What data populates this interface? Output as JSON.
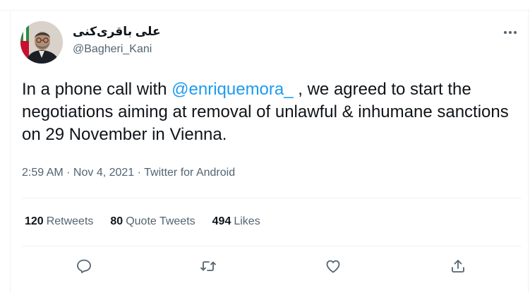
{
  "author": {
    "display_name": "علی باقری‌کنی",
    "handle": "@Bagheri_Kani"
  },
  "tweet": {
    "text_before": "In a phone call with ",
    "mention": "@enriquemora_",
    "text_after": " , we agreed to start the negotiations aiming at removal of unlawful & inhumane sanctions on 29 November in Vienna."
  },
  "meta": {
    "time": "2:59 AM",
    "dot1": " · ",
    "date": "Nov 4, 2021",
    "dot2": " · ",
    "source": "Twitter for Android"
  },
  "stats": {
    "retweets_count": "120",
    "retweets_label": "Retweets",
    "quotes_count": "80",
    "quotes_label": "Quote Tweets",
    "likes_count": "494",
    "likes_label": "Likes"
  },
  "icons": {
    "more": "more-icon",
    "reply": "reply-icon",
    "retweet": "retweet-icon",
    "like": "like-icon",
    "share": "share-icon"
  },
  "colors": {
    "accent": "#1d9bf0",
    "text": "#0f1419",
    "secondary": "#536471",
    "border": "#eff3f4"
  }
}
